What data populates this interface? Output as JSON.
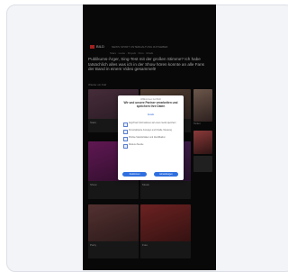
{
  "app": {
    "brand": "BILD",
    "nav": "NEWS  SPORT  UNTERHALTUNG  RATGEBER",
    "subnav": "Stars · Leute · Royals · Kino · Musik"
  },
  "article": {
    "headline": "Publikums-Ärger, Sing-Test mit der großen Stimme? Ich habe tatsächlich alles was ich in der Show hören konnte an alle Fans der Band in einem Video gesammelt!",
    "meta": "Wieder ein Fall"
  },
  "tiles": [
    {
      "caption": "Stars"
    },
    {
      "caption": "Leute"
    },
    {
      "caption": "Show"
    },
    {
      "caption": "Musik"
    },
    {
      "caption": "Party"
    },
    {
      "caption": "Foto"
    },
    {
      "caption": "Kino"
    }
  ],
  "side": {
    "share": "Teilen"
  },
  "consent": {
    "pre": "Willkommen bei BILD",
    "title": "Wir und unsere Partner verarbeiten und speichern Ihre Daten",
    "link": "Details",
    "options": [
      {
        "label": "Zugriff auf Informationen auf einem Gerät speichern"
      },
      {
        "label": "Personalisierte Anzeigen und Inhalte, Messung"
      },
      {
        "label": "Präzise Standortdaten und Identifikation"
      },
      {
        "label": "Weitere Zwecke"
      }
    ],
    "buttons": {
      "primary": "Zustimmen",
      "secondary": "Einstellungen"
    }
  },
  "colors": {
    "accent": "#2f6fe0",
    "brand": "#d02a2a"
  }
}
